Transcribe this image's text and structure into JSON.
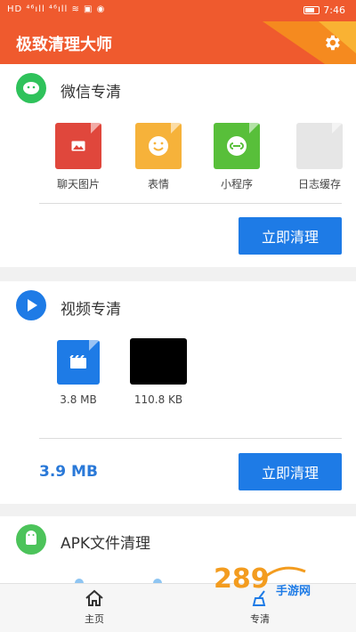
{
  "status_bar": {
    "left": "HD ⁴⁶ıll ⁴⁶ıll ≋ ▣ ◉",
    "time": "7:46"
  },
  "app": {
    "title": "极致清理大师"
  },
  "wechat": {
    "title": "微信专清",
    "files": [
      {
        "label": "聊天图片",
        "color": "#e0473c",
        "icon": "image-icon"
      },
      {
        "label": "表情",
        "color": "#f6b23a",
        "icon": "smile-icon"
      },
      {
        "label": "小程序",
        "color": "#58bf3a",
        "icon": "miniprogram-icon"
      },
      {
        "label": "日志缓存",
        "color": "#e6e6e6",
        "icon": "log-icon"
      }
    ],
    "clean_button": "立即清理"
  },
  "video": {
    "title": "视频专清",
    "files": [
      {
        "label": "3.8 MB",
        "icon": "video-file-icon"
      },
      {
        "label": "110.8 KB",
        "icon": "video-thumbnail"
      }
    ],
    "total": "3.9 MB",
    "clean_button": "立即清理"
  },
  "apk": {
    "title": "APK文件清理"
  },
  "nav": {
    "home": "主页",
    "special": "专清"
  },
  "watermark": {
    "text": "289",
    "sub": "手游网"
  },
  "colors": {
    "primary": "#ef5a2e",
    "accent": "#1e7be6",
    "wechat_green": "#2fc25b"
  }
}
